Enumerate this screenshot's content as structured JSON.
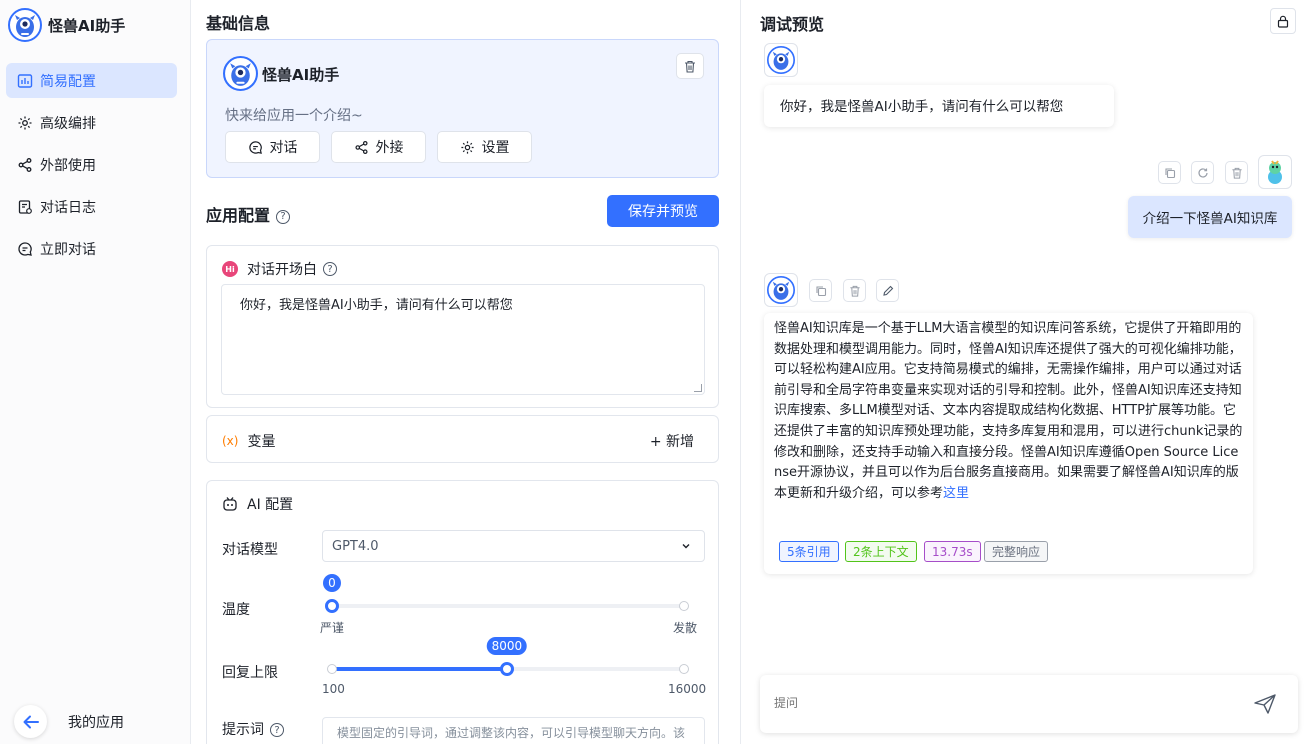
{
  "app": {
    "name": "怪兽AI助手",
    "colors": {
      "accent": "#3370ff",
      "active_bg": "#dbe6ff"
    }
  },
  "sidebar": {
    "items": [
      {
        "label": "简易配置",
        "icon": "dashboard-icon",
        "active": true
      },
      {
        "label": "高级编排",
        "icon": "gear-icon",
        "active": false
      },
      {
        "label": "外部使用",
        "icon": "share-icon",
        "active": false
      },
      {
        "label": "对话日志",
        "icon": "log-icon",
        "active": false
      },
      {
        "label": "立即对话",
        "icon": "chat-icon",
        "active": false
      }
    ],
    "back_label": "我的应用"
  },
  "basic_info": {
    "title": "基础信息",
    "app_name": "怪兽AI助手",
    "intro_placeholder": "快来给应用一个介绍~",
    "buttons": {
      "chat": "对话",
      "share": "外接",
      "settings": "设置"
    }
  },
  "app_config": {
    "title": "应用配置",
    "save_label": "保存并预览",
    "opener": {
      "title": "对话开场白",
      "badge": "Hi",
      "text": "你好，我是怪兽AI小助手，请问有什么可以帮您"
    },
    "variables": {
      "title": "变量",
      "icon_text": "(x)",
      "add_label": "+ 新增"
    },
    "ai": {
      "title": "AI 配置",
      "model_label": "对话模型",
      "model_value": "GPT4.0",
      "temperature": {
        "label": "温度",
        "value": 0,
        "value_text": "0",
        "min": 0,
        "max": 10,
        "min_label": "严谨",
        "max_label": "发散"
      },
      "max_tokens": {
        "label": "回复上限",
        "value": 8000,
        "value_text": "8000",
        "min": 100,
        "max": 16000,
        "min_label": "100",
        "max_label": "16000"
      },
      "prompt_label": "提示词",
      "prompt_placeholder": "模型固定的引导词，通过调整该内容，可以引导模型聊天方向。该内容会被固定在上下文的开头。可使用变量，例如 {{language}}"
    }
  },
  "preview": {
    "title": "调试预览",
    "greeting": "你好，我是怪兽AI小助手，请问有什么可以帮您",
    "user_question": "介绍一下怪兽AI知识库",
    "answer": "怪兽AI知识库是一个基于LLM大语言模型的知识库问答系统，它提供了开箱即用的数据处理和模型调用能力。同时，怪兽AI知识库还提供了强大的可视化编排功能，可以轻松构建AI应用。它支持简易模式的编排，无需操作编排，用户可以通过对话前引导和全局字符串变量来实现对话的引导和控制。此外，怪兽AI知识库还支持知识库搜索、多LLM模型对话、文本内容提取成结构化数据、HTTP扩展等功能。它还提供了丰富的知识库预处理功能，支持多库复用和混用，可以进行chunk记录的修改和删除，还支持手动输入和直接分段。怪兽AI知识库遵循Open Source License开源协议，并且可以作为后台服务直接商用。如果需要了解怪兽AI知识库的版本更新和升级介绍，可以参考",
    "answer_link": "这里",
    "tags": [
      {
        "label": "5条引用",
        "color": "#3370ff"
      },
      {
        "label": "2条上下文",
        "color": "#52c41a"
      },
      {
        "label": "13.73s",
        "color": "#a64dc9"
      },
      {
        "label": "完整响应",
        "color": "#6b7280"
      }
    ],
    "input_placeholder": "提问"
  }
}
